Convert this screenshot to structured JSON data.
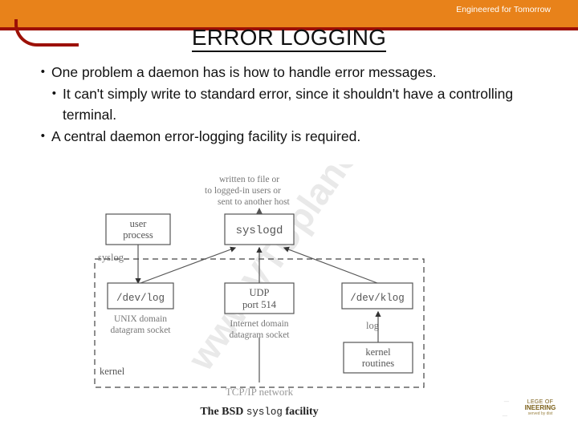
{
  "header": {
    "tagline": "Engineered for Tomorrow",
    "band_color": "#E8821A",
    "rule_color": "#9C1006"
  },
  "title": "ERROR LOGGING",
  "bullets": [
    {
      "mark": "•",
      "text": "One problem a daemon has is how to handle error messages.",
      "indent": 0
    },
    {
      "mark": "•",
      "text": " It can't simply write to standard error, since it shouldn't have a controlling terminal.",
      "indent": 1
    },
    {
      "mark": "•",
      "text": "A central daemon error-logging facility is required.",
      "indent": 0
    }
  ],
  "figure": {
    "watermark": "www.VTUplanet.com",
    "caption_prefix": "The BSD ",
    "caption_mono": "syslog",
    "caption_suffix": " facility",
    "top_note_lines": [
      "written to file or",
      "to logged-in users or",
      "sent to another host"
    ],
    "boxes": {
      "user_process": [
        "user",
        "process"
      ],
      "syslogd": "syslogd",
      "dev_log": "/dev/log",
      "dev_log_sub": [
        "UNIX domain",
        "datagram socket"
      ],
      "udp": [
        "UDP",
        "port 514"
      ],
      "udp_sub": [
        "Internet domain",
        "datagram socket"
      ],
      "dev_klog": "/dev/klog",
      "kernel_routines": [
        "kernel",
        "routines"
      ]
    },
    "labels": {
      "syslog": "syslog",
      "log": "log",
      "kernel": "kernel",
      "network": "TCP/IP network"
    }
  },
  "footer": {
    "logo_line1": "LEGE OF",
    "logo_line2": "INEERING",
    "logo_line3": "served by dist"
  }
}
